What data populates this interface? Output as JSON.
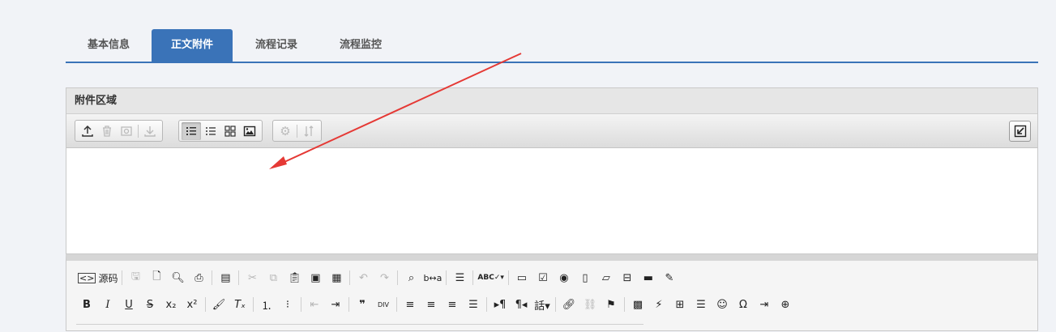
{
  "tabs": [
    {
      "label": "基本信息",
      "active": false
    },
    {
      "label": "正文附件",
      "active": true
    },
    {
      "label": "流程记录",
      "active": false
    },
    {
      "label": "流程监控",
      "active": false
    }
  ],
  "attachment_panel": {
    "title": "附件区域",
    "toolbar_groups": [
      {
        "buttons": [
          {
            "icon": "upload-icon",
            "enabled": true
          },
          {
            "icon": "trash-icon",
            "enabled": false
          },
          {
            "icon": "preview-icon",
            "enabled": false
          },
          {
            "icon": "download-icon",
            "enabled": false
          }
        ]
      },
      {
        "buttons": [
          {
            "icon": "detail-list-icon",
            "enabled": true,
            "pressed": true
          },
          {
            "icon": "list-icon",
            "enabled": true
          },
          {
            "icon": "grid-icon",
            "enabled": true
          },
          {
            "icon": "image-view-icon",
            "enabled": true
          }
        ]
      },
      {
        "buttons": [
          {
            "icon": "gear-icon",
            "enabled": false
          },
          {
            "icon": "sort-icon",
            "enabled": false
          }
        ]
      }
    ],
    "corner_icon": "collapse-arrow-icon"
  },
  "editor": {
    "source_label": "源码",
    "accent_color": "#3a73b8"
  },
  "annotation_arrow_color": "#e53935"
}
